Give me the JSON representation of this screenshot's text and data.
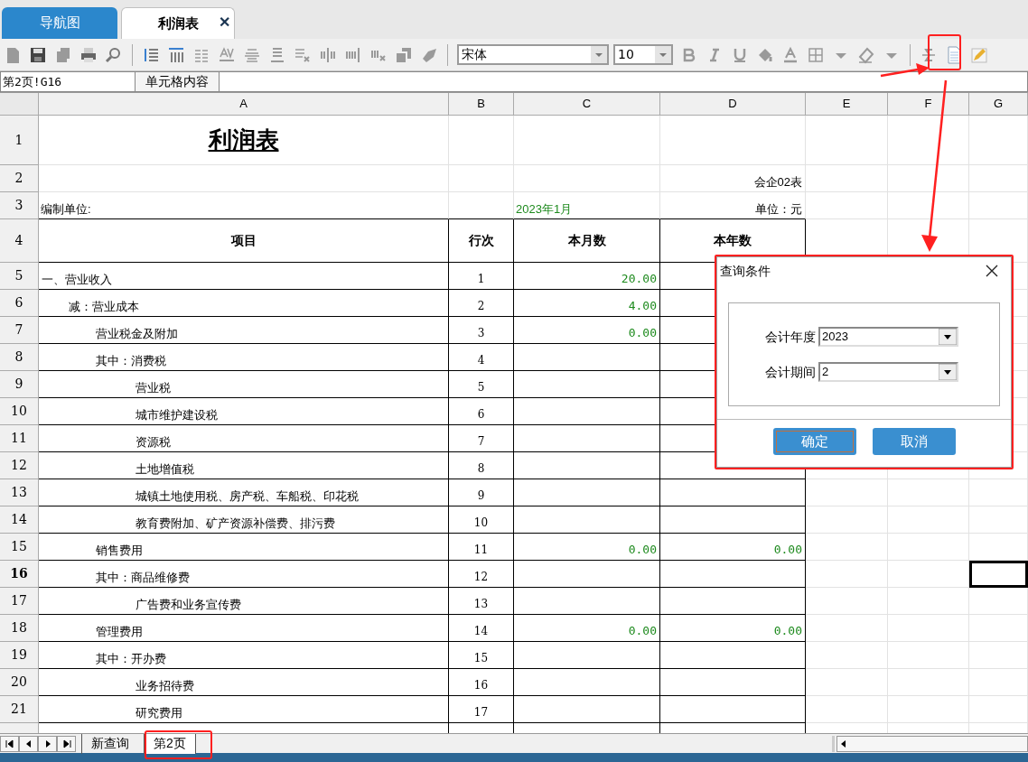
{
  "doc_tabs": [
    {
      "label": "导航图",
      "selected": false
    },
    {
      "label": "利润表",
      "selected": true,
      "close": "✕"
    }
  ],
  "toolbar": {
    "font": "宋体",
    "size": "10"
  },
  "formula_bar": {
    "cell_ref": "第2页!G16",
    "label": "单元格内容"
  },
  "columns": [
    "A",
    "B",
    "C",
    "D",
    "E",
    "F",
    "G"
  ],
  "sheet": {
    "title": "利润表",
    "form_no": "会企02表",
    "unit_label": "编制单位:",
    "period": "2023年1月",
    "currency": "单位：元",
    "headers": [
      "项目",
      "行次",
      "本月数",
      "本年数"
    ],
    "rows": [
      {
        "num": "1",
        "selected": false
      },
      {
        "num": "2",
        "selected": false
      },
      {
        "num": "3",
        "selected": false
      },
      {
        "num": "4",
        "selected": false
      },
      {
        "num": "5",
        "selected": false,
        "kind": "heading",
        "item": "一、营业收入",
        "line": "1",
        "month": "20.00"
      },
      {
        "num": "6",
        "selected": false,
        "kind": "deduct",
        "item": "减：营业成本",
        "line": "2",
        "month": "4.00"
      },
      {
        "num": "7",
        "selected": false,
        "kind": "item",
        "item": "营业税金及附加",
        "line": "3",
        "month": "0.00"
      },
      {
        "num": "8",
        "selected": false,
        "kind": "item",
        "item": "其中：消费税",
        "line": "4"
      },
      {
        "num": "9",
        "selected": false,
        "kind": "detail",
        "item": "营业税",
        "line": "5"
      },
      {
        "num": "10",
        "selected": false,
        "kind": "detail",
        "item": "城市维护建设税",
        "line": "6"
      },
      {
        "num": "11",
        "selected": false,
        "kind": "detail",
        "item": "资源税",
        "line": "7"
      },
      {
        "num": "12",
        "selected": false,
        "kind": "detail",
        "item": "土地增值税",
        "line": "8"
      },
      {
        "num": "13",
        "selected": false,
        "kind": "detail",
        "item": "城镇土地使用税、房产税、车船税、印花税",
        "line": "9"
      },
      {
        "num": "14",
        "selected": false,
        "kind": "detail",
        "item": "教育费附加、矿产资源补偿费、排污费",
        "line": "10"
      },
      {
        "num": "15",
        "selected": false,
        "kind": "item",
        "item": "销售费用",
        "line": "11",
        "month": "0.00",
        "year": "0.00"
      },
      {
        "num": "16",
        "selected": true,
        "kind": "item",
        "item": "其中：商品维修费",
        "line": "12"
      },
      {
        "num": "17",
        "selected": false,
        "kind": "detail",
        "item": "广告费和业务宣传费",
        "line": "13"
      },
      {
        "num": "18",
        "selected": false,
        "kind": "item",
        "item": "管理费用",
        "line": "14",
        "month": "0.00",
        "year": "0.00"
      },
      {
        "num": "19",
        "selected": false,
        "kind": "item",
        "item": "其中：开办费",
        "line": "15"
      },
      {
        "num": "20",
        "selected": false,
        "kind": "detail",
        "item": "业务招待费",
        "line": "16"
      },
      {
        "num": "21",
        "selected": false,
        "kind": "detail",
        "item": "研究费用",
        "line": "17"
      }
    ]
  },
  "dialog": {
    "title": "查询条件",
    "fields": [
      {
        "label": "会计年度",
        "value": "2023"
      },
      {
        "label": "会计期间",
        "value": "2"
      }
    ],
    "buttons": [
      {
        "label": "确定",
        "focused": true
      },
      {
        "label": "取消",
        "focused": false
      }
    ]
  },
  "sheet_tabs": [
    {
      "label": "新查询",
      "selected": false
    },
    {
      "label": "第2页",
      "selected": true
    }
  ]
}
